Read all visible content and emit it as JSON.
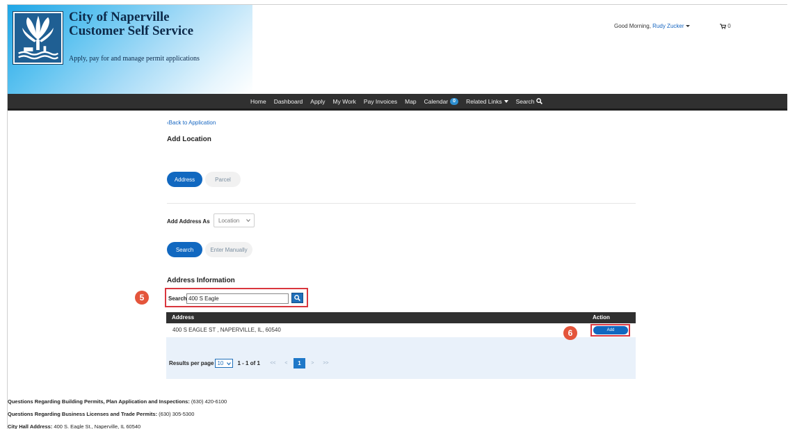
{
  "header": {
    "brand_title_line1": "City of Naperville",
    "brand_title_line2": "Customer Self Service",
    "tagline": "Apply, pay for and manage permit applications",
    "greeting": "Good Morning,",
    "user_name": "Rudy Zucker",
    "cart_count": "0"
  },
  "nav": {
    "items": [
      "Home",
      "Dashboard",
      "Apply",
      "My Work",
      "Pay Invoices",
      "Map"
    ],
    "calendar_label": "Calendar",
    "calendar_badge": "0",
    "related_links_label": "Related Links",
    "search_label": "Search"
  },
  "page": {
    "back_link": "Back to Application",
    "title": "Add Location",
    "location_tabs": [
      "Address",
      "Parcel"
    ],
    "add_address_as_label": "Add Address As",
    "add_address_as_value": "Location",
    "mode_tabs": [
      "Search",
      "Enter Manually"
    ],
    "section_title": "Address Information",
    "search_label": "Search",
    "search_value": "400 S Eagle"
  },
  "results": {
    "columns": [
      "Address",
      "Action"
    ],
    "rows": [
      {
        "address": "400 S EAGLE ST , NAPERVILLE, IL, 60540",
        "action_label": "Add"
      }
    ],
    "results_per_page_label": "Results per page",
    "results_per_page_value": "10",
    "range_text": "1 - 1 of 1",
    "pager": {
      "first": "<<",
      "prev": "<",
      "current": "1",
      "next": ">",
      "last": ">>"
    }
  },
  "callouts": {
    "step5": "5",
    "step6": "6"
  },
  "footer": {
    "lines": [
      {
        "label": "Questions Regarding Building Permits, Plan Application and Inspections:",
        "value": " (630) 420-6100"
      },
      {
        "label": "Questions Regarding Business Licenses and Trade Permits:",
        "value": " (630) 305-5300"
      },
      {
        "label": "City Hall Address:",
        "value": " 400 S. Eagle St., Naperville, IL 60540"
      }
    ]
  },
  "colors": {
    "primary_blue": "#1168c0",
    "navbar": "#303030",
    "highlight_red": "#d9363e",
    "callout_orange": "#e4553b",
    "results_panel": "#e9f1fa"
  }
}
